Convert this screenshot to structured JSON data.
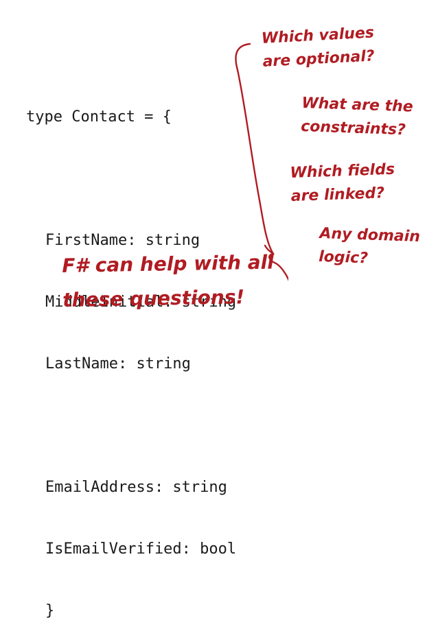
{
  "code": {
    "lines": [
      "type Contact = {",
      "",
      "FirstName: string",
      "MiddleInitial: string",
      "LastName: string",
      "",
      "EmailAddress: string",
      "IsEmailVerified: bool",
      "}"
    ]
  },
  "annotations": {
    "q1": [
      "Which values",
      "are optional?"
    ],
    "q2": [
      "What are the",
      "constraints?"
    ],
    "q3": [
      "Which fields",
      "are linked?"
    ],
    "q4": [
      "Any domain",
      "logic?"
    ],
    "conclusion": [
      "F# can help with all",
      "these questions!"
    ]
  },
  "colors": {
    "annotation": "#b01c22",
    "code": "#1a1a1a",
    "background": "#ffffff"
  }
}
